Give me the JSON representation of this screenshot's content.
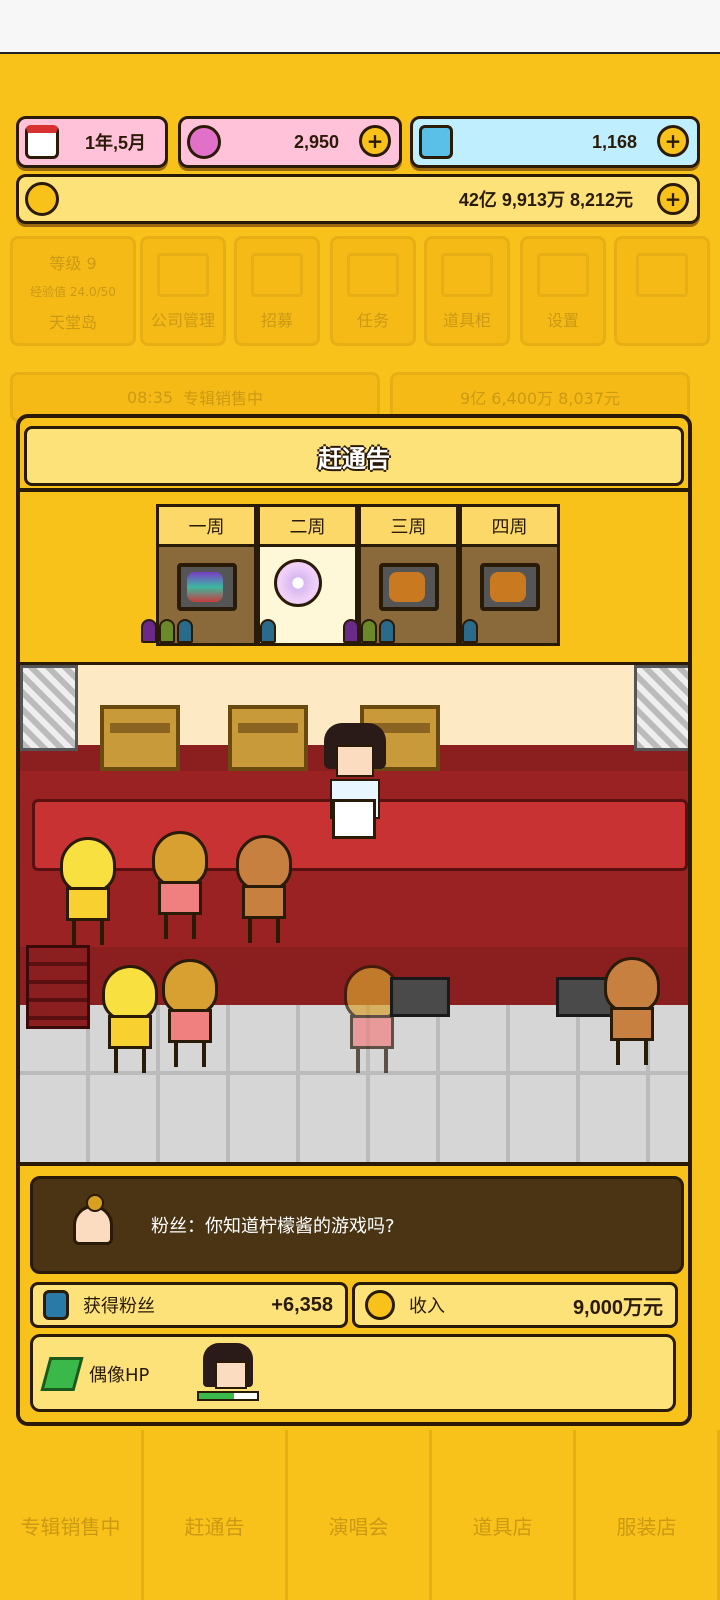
{
  "top_bar": {
    "date": "1年,5月",
    "pink_currency": "2,950",
    "blue_currency": "1,168",
    "money": "42亿 9,913万 8,212元"
  },
  "background_ui": {
    "level_label": "等级",
    "level_value": "9",
    "exp_label": "经验值",
    "exp_value": "24.0/50",
    "location": "天堂岛",
    "tiles": [
      "公司管理",
      "招募",
      "任务",
      "道具柜",
      "设置"
    ],
    "activity_time": "08:35",
    "activity_name": "专辑销售中",
    "activity_money": "9亿 6,400万 8,037元"
  },
  "modal": {
    "title": "赶通告",
    "weeks": [
      {
        "label": "一周",
        "icon": "rainbow-tv-icon",
        "selected": false
      },
      {
        "label": "二周",
        "icon": "cd-icon",
        "selected": true
      },
      {
        "label": "三周",
        "icon": "tv-icon",
        "selected": false
      },
      {
        "label": "四周",
        "icon": "tv-icon",
        "selected": false
      }
    ],
    "dialog": "粉丝：你知道柠檬酱的游戏吗?",
    "fans_label": "获得粉丝",
    "fans_value": "+6,358",
    "income_label": "收入",
    "income_value": "9,000万元",
    "hp_label": "偶像HP",
    "hp_fraction": 0.6
  },
  "bottom_nav": [
    "专辑销售中",
    "赶通告",
    "演唱会",
    "道具店",
    "服装店"
  ],
  "colors": {
    "background": "#f8c21a",
    "pink_panel": "#ffc2d8",
    "blue_panel": "#bfeeff",
    "dark": "#2a1a08"
  }
}
